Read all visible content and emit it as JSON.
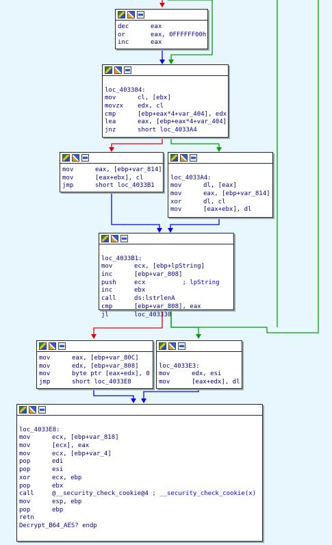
{
  "colors": {
    "background": "#e8f7fd",
    "edge_true": "#00a000",
    "edge_false": "#e00000",
    "edge_uncond": "#0000ff"
  },
  "toolbar_icons": [
    "graph-overview-icon",
    "edit-color-icon",
    "code-view-icon"
  ],
  "blocks": [
    {
      "id": "b1",
      "lines": [
        {
          "m": "dec",
          "o": "eax"
        },
        {
          "m": "or",
          "o": "eax, 0FFFFFF00h"
        },
        {
          "m": "inc",
          "o": "eax"
        }
      ]
    },
    {
      "id": "b2",
      "lines": [
        {
          "t": ""
        },
        {
          "t": "loc_403384:"
        },
        {
          "m": "mov",
          "o": "cl, [ebx]"
        },
        {
          "m": "movzx",
          "o": "edx, cl"
        },
        {
          "m": "cmp",
          "o": "[ebp+eax*4+var_404], edx"
        },
        {
          "m": "lea",
          "o": "eax, [ebp+eax*4+var_404]"
        },
        {
          "m": "jnz",
          "o": "short loc_4033A4"
        }
      ]
    },
    {
      "id": "b3",
      "lines": [
        {
          "m": "mov",
          "o": "eax, [ebp+var_814]"
        },
        {
          "m": "mov",
          "o": "[eax+ebx], cl"
        },
        {
          "m": "jmp",
          "o": "short loc_4033B1"
        }
      ]
    },
    {
      "id": "b4",
      "lines": [
        {
          "t": ""
        },
        {
          "t": "loc_4033A4:"
        },
        {
          "m": "mov",
          "o": "dl, [eax]"
        },
        {
          "m": "mov",
          "o": "eax, [ebp+var_814]"
        },
        {
          "m": "xor",
          "o": "dl, cl"
        },
        {
          "m": "mov",
          "o": "[eax+ebx], dl"
        }
      ]
    },
    {
      "id": "b5",
      "lines": [
        {
          "t": ""
        },
        {
          "t": "loc_4033B1:"
        },
        {
          "m": "mov",
          "o": "ecx, [ebp+lpString]"
        },
        {
          "m": "inc",
          "o": "[ebp+var_808]"
        },
        {
          "m": "push",
          "o": "ecx",
          "c": "; lpString"
        },
        {
          "m": "inc",
          "o": "ebx"
        },
        {
          "m": "call",
          "o": "ds:lstrlenA"
        },
        {
          "m": "cmp",
          "o": "[ebp+var_808], eax"
        },
        {
          "m": "jl",
          "o": "loc_403330"
        }
      ]
    },
    {
      "id": "b6",
      "lines": [
        {
          "m": "mov",
          "o": "eax, [ebp+var_80C]"
        },
        {
          "m": "mov",
          "o": "edx, [ebp+var_808]"
        },
        {
          "m": "mov",
          "o": "byte ptr [eax+edx], 0"
        },
        {
          "m": "jmp",
          "o": "short loc_4033E8"
        }
      ]
    },
    {
      "id": "b7",
      "lines": [
        {
          "t": ""
        },
        {
          "t": "loc_4033E3:"
        },
        {
          "m": "mov",
          "o": "edx, esi"
        },
        {
          "m": "mov",
          "o": "[eax+edx], dl"
        }
      ]
    },
    {
      "id": "b8",
      "lines": [
        {
          "t": ""
        },
        {
          "t": "loc_4033E8:"
        },
        {
          "m": "mov",
          "o": "ecx, [ebp+var_818]"
        },
        {
          "m": "mov",
          "o": "[ecx], eax"
        },
        {
          "m": "mov",
          "o": "ecx, [ebp+var_4]"
        },
        {
          "m": "pop",
          "o": "edi"
        },
        {
          "m": "pop",
          "o": "esi"
        },
        {
          "m": "xor",
          "o": "ecx, ebp"
        },
        {
          "m": "pop",
          "o": "ebx"
        },
        {
          "m": "call",
          "o": "@__security_check_cookie@4",
          "c": "; __security_check_cookie(x)"
        },
        {
          "m": "mov",
          "o": "esp, ebp"
        },
        {
          "m": "pop",
          "o": "ebp"
        },
        {
          "m": "retn",
          "o": ""
        },
        {
          "t": "Decrypt_B64_AES? endp"
        }
      ]
    }
  ]
}
